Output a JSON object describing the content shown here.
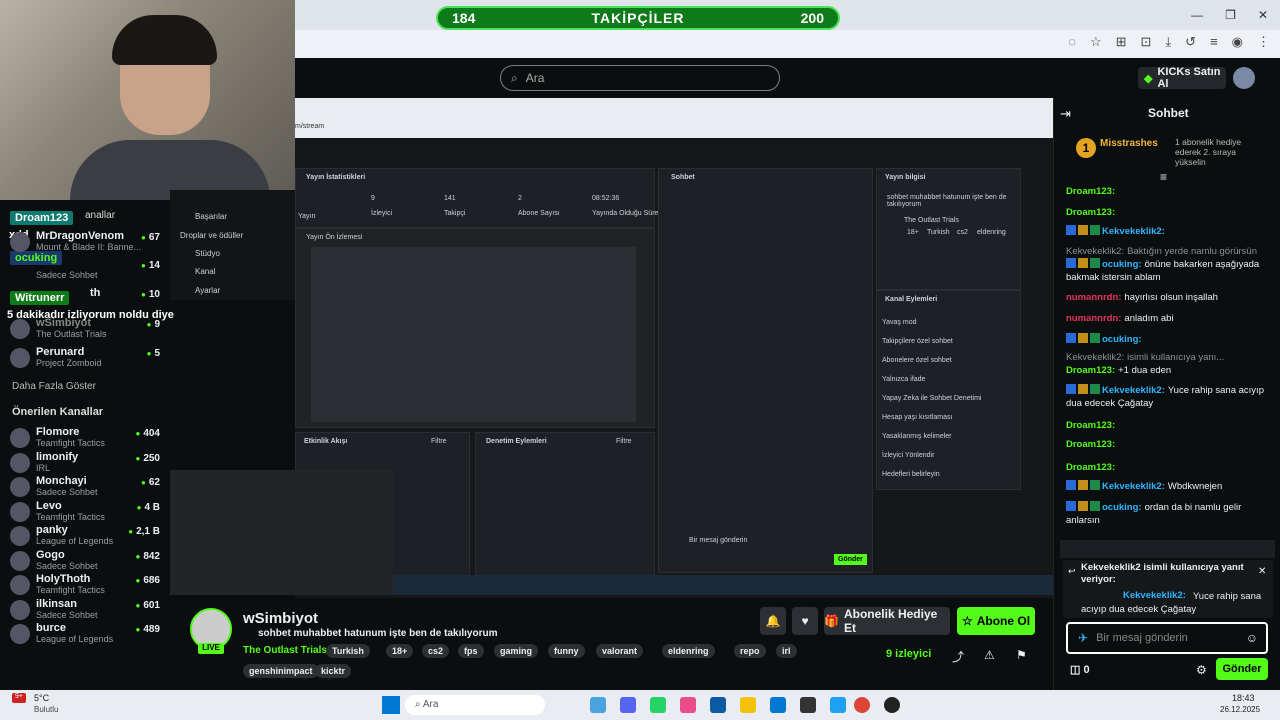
{
  "browser": {
    "follow_count_left": "184",
    "follow_title": "TAKİPÇİLER",
    "follow_count_right": "200"
  },
  "kick": {
    "search_placeholder": "Ara",
    "ai_label": "KICKs Satın Al",
    "chat_title": "Sohbet"
  },
  "webcam": {
    "overlays": [
      "xdd",
      "Droam123",
      "ocuking",
      "Witrunerr",
      "5 dakikadır izliyorum noldu diye"
    ]
  },
  "sidebar": {
    "partial": [
      {
        "name": "MrDragonVenom",
        "cat": "Mount & Blade II: Banne...",
        "viewers": "67"
      },
      {
        "name": "",
        "cat": "Sadece Sohbet",
        "viewers": "14"
      },
      {
        "name": "th",
        "cat": "",
        "viewers": "10"
      },
      {
        "name": "wSimbiyot",
        "cat": "The Outlast Trials",
        "viewers": "9"
      },
      {
        "name": "Perunard",
        "cat": "Project Zomboid",
        "viewers": "5"
      }
    ],
    "more": "Daha Fazla Göster",
    "recommended_title": "Önerilen Kanallar",
    "channels_partial_label": "anallar",
    "recommended": [
      {
        "name": "Flomore",
        "cat": "Teamfight Tactics",
        "viewers": "404"
      },
      {
        "name": "limonify",
        "cat": "IRL",
        "viewers": "250"
      },
      {
        "name": "Monchayi",
        "cat": "Sadece Sohbet",
        "viewers": "62"
      },
      {
        "name": "Levo",
        "cat": "Teamfight Tactics",
        "viewers": "4 B"
      },
      {
        "name": "panky",
        "cat": "League of Legends",
        "viewers": "2,1 B"
      },
      {
        "name": "Gogo",
        "cat": "Sadece Sohbet",
        "viewers": "842"
      },
      {
        "name": "HolyThoth",
        "cat": "Teamfight Tactics",
        "viewers": "686"
      },
      {
        "name": "ilkinsan",
        "cat": "Sadece Sohbet",
        "viewers": "601"
      },
      {
        "name": "burce",
        "cat": "League of Legends",
        "viewers": "489"
      }
    ]
  },
  "inner": {
    "menu": [
      "Başarılar",
      "Droplar ve ödüller",
      "Stüdyo",
      "Kanal",
      "Ayarlar"
    ],
    "url": "m/stream",
    "stats_title": "Yayın İstatistikleri",
    "stats": [
      {
        "v": "9",
        "l": "İzleyici"
      },
      {
        "v": "141",
        "l": "Takipçi"
      },
      {
        "v": "2",
        "l": "Abone Sayısı"
      },
      {
        "v": "08:52:36",
        "l": "Yayında Olduğu Süre"
      }
    ],
    "stats_first": "Yayın",
    "preview": "Yayın Ön İzlemesi",
    "activity": "Etkinlik Akışı",
    "filter": "Filtre",
    "mod": "Denetim Eylemleri",
    "chat": "Sohbet",
    "info": "Yayın bilgisi",
    "info_text": "sohbet muhabbet hatunum işte ben de takılıyorum",
    "game": "The Outlast Trials",
    "tags": [
      "18+",
      "Turkish",
      "cs2",
      "eldenring"
    ],
    "actions": "Kanal Eylemleri",
    "action_items": [
      "Yavaş mod",
      "Takipçilere özel sohbet",
      "Abonelere özel sohbet",
      "Yalnızca ifade",
      "Yapay Zeka ile Sohbet Denetimi",
      "Hesap yaşı kısıtlaması",
      "Yasaklanmış kelimeler",
      "İzleyici Yönlendir",
      "Hedefleri belirleyin"
    ],
    "send": "Gönder",
    "msg_placeholder": "Bir mesaj gönderin"
  },
  "stream": {
    "name": "wSimbiyot",
    "live": "LIVE",
    "title": "sohbet muhabbet hatunum işte ben de takılıyorum",
    "game": "The Outlast Trials",
    "tags": [
      "Turkish",
      "18+",
      "cs2",
      "fps",
      "gaming",
      "funny",
      "valorant",
      "eldenring",
      "repo",
      "irl"
    ],
    "tags2": [
      "genshinimpact",
      "kicktr"
    ],
    "gift": "Abonelik Hediye Et",
    "sub": "Abone Ol",
    "viewers": "9 izleyici"
  },
  "chat": {
    "pinned_user": "Misstrashes",
    "pinned_count": "1",
    "pinned_text": "1 abonelik hediye ederek 2. sıraya yükselin",
    "messages": [
      {
        "u": "Droam123:",
        "t": "",
        "c": "g"
      },
      {
        "u": "Droam123:",
        "t": "",
        "c": "g"
      },
      {
        "u": "Kekvekeklik2:",
        "t": "",
        "c": "b"
      },
      {
        "u": "Kekvekeklik2:",
        "t": "Baktığın yerde namlu görürsün a...",
        "c": "gray"
      },
      {
        "u": "ocuking:",
        "t": "önüne bakarken aşağıyada bakmak istersin ablam",
        "c": "b"
      },
      {
        "u": "numannrdn:",
        "t": "hayırlısı olsun inşallah",
        "c": "r"
      },
      {
        "u": "numannrdn:",
        "t": "anladım abi",
        "c": "r"
      },
      {
        "u": "ocuking:",
        "t": "",
        "c": "b"
      },
      {
        "u": "Kekvekeklik2:",
        "t": "isimli kullanıcıya yanı...",
        "c": "gray"
      },
      {
        "u": "Droam123:",
        "t": "+1 dua eden",
        "c": "g"
      },
      {
        "u": "Kekvekeklik2:",
        "t": "Yuce rahip sana acıyıp dua edecek Çağatay",
        "c": "b"
      },
      {
        "u": "Droam123:",
        "t": "",
        "c": "g"
      },
      {
        "u": "Droam123:",
        "t": "",
        "c": "g"
      },
      {
        "u": "Droam123:",
        "t": "",
        "c": "g"
      },
      {
        "u": "Kekvekeklik2:",
        "t": "Wbdkwnejen",
        "c": "b"
      },
      {
        "u": "ocuking:",
        "t": "ordan da bi namlu gelir anlarsın",
        "c": "b"
      }
    ],
    "reply_title": "Kekvekeklik2 isimli kullanıcıya yanıt veriyor:",
    "reply_user": "Kekvekeklik2:",
    "reply_text": "Yuce rahip sana acıyıp dua edecek Çağatay",
    "input_placeholder": "Bir mesaj gönderin",
    "count": "0",
    "send": "Gönder"
  },
  "taskbar": {
    "temp": "5°C",
    "weather": "Bulutlu",
    "search": "Ara",
    "time": "18:43",
    "date": "26.12.2025",
    "badge": "9+"
  }
}
